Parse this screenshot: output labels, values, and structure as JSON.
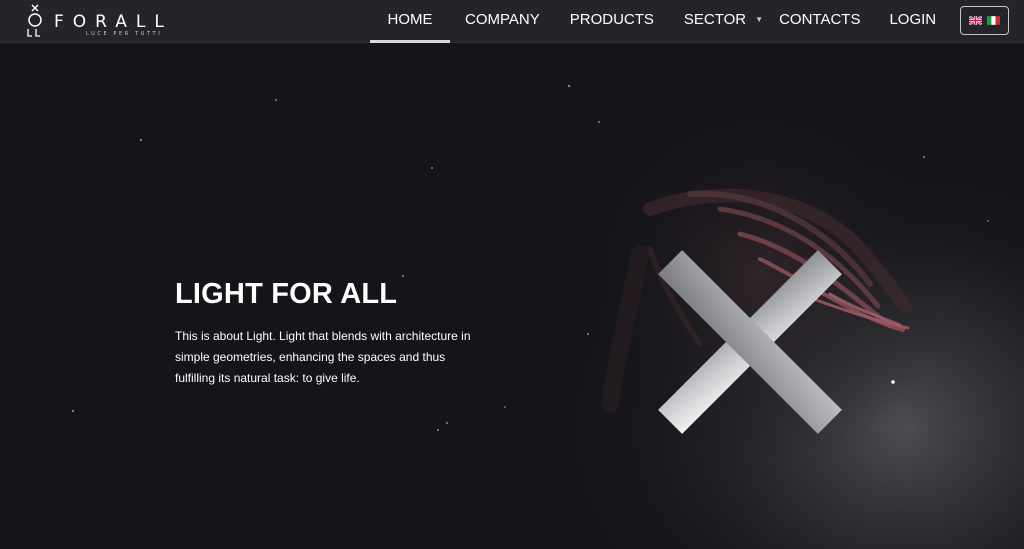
{
  "brand": {
    "name": "FORALL",
    "tagline": "LUCE PER TUTTI",
    "mark_letters": "LL",
    "icon": "forall-x-logo-icon"
  },
  "nav": {
    "items": [
      {
        "label": "HOME",
        "active": true
      },
      {
        "label": "COMPANY",
        "active": false
      },
      {
        "label": "PRODUCTS",
        "active": false
      },
      {
        "label": "SECTOR",
        "active": false,
        "has_dropdown": true,
        "caret_icon": "chevron-down-icon"
      },
      {
        "label": "CONTACTS",
        "active": false
      },
      {
        "label": "LOGIN",
        "active": false
      }
    ],
    "languages": [
      {
        "code": "en",
        "icon": "uk-flag-icon"
      },
      {
        "code": "it",
        "icon": "italy-flag-icon"
      }
    ]
  },
  "hero": {
    "title": "LIGHT FOR ALL",
    "text": "This is about Light. Light that blends with architecture in simple geometries, enhancing the spaces and thus fulfilling its natural task: to give life.",
    "image": "glowing-x-with-hand-image"
  },
  "colors": {
    "header_bg": "#23252a",
    "hero_bg": "#141419",
    "text": "#ffffff",
    "active_underline": "#d7d8db"
  }
}
